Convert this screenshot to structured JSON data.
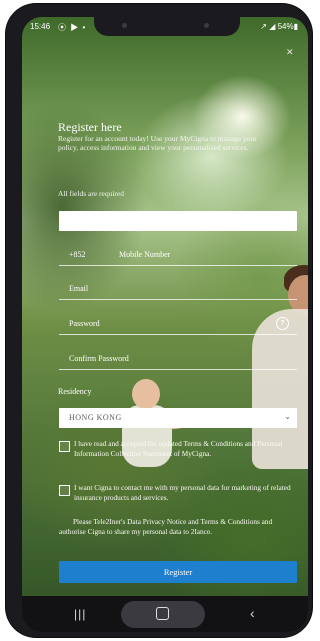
{
  "status": {
    "time": "15:46",
    "icons_left": "⦿ ▶ •",
    "right": "↗ ◢ 54%▮"
  },
  "form": {
    "title": "Register here",
    "intro": "Register for an account today! Use your MyCigna to manage your policy, access information and view your personalised services.",
    "required_note": "All fields are required",
    "country_code": "+852",
    "mobile_label": "Mobile Number",
    "email_label": "Email",
    "password_label": "Password",
    "confirm_label": "Confirm Password",
    "residency_label": "Residency",
    "residency_value": "HONG KONG",
    "consent1": "I have read and accepted the updated Terms & Conditions and Personal Information Collection Statement of MyCigna.",
    "consent2": "I want Cigna to contact me with my personal data for marketing of related insurance products and services.",
    "consent3": "Please Tele2Iner's Data Privacy Notice and Terms & Conditions and authorise Cigna to share my personal data to 2Iance.",
    "register_label": "Register"
  },
  "icons": {
    "close": "✕",
    "eye": "?",
    "chevron": "⌄",
    "recents": "|||",
    "back": "‹"
  }
}
